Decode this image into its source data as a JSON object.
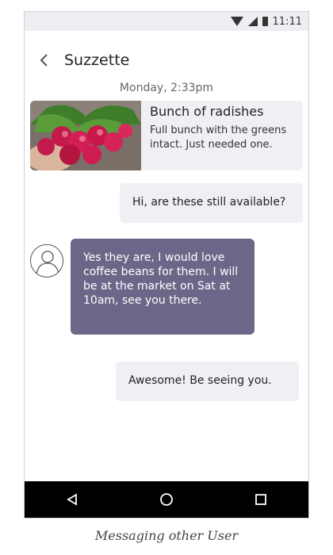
{
  "status_bar": {
    "time": "11:11"
  },
  "header": {
    "title": "Suzzette"
  },
  "timestamp": "Monday, 2:33pm",
  "listing": {
    "title": "Bunch of radishes",
    "description": "Full bunch with the greens intact. Just needed one."
  },
  "messages": [
    {
      "direction": "sent",
      "text": "Hi, are these still available?"
    },
    {
      "direction": "received",
      "text": "Yes they are, I would love coffee beans for them. I will be at the market on Sat at 10am, see you there."
    },
    {
      "direction": "sent",
      "text": "Awesome! Be seeing you."
    }
  ],
  "caption": "Messaging other User",
  "colors": {
    "received_bubble": "#6b6788",
    "sent_bubble": "#f0f0f4",
    "nav_bar": "#000000"
  }
}
